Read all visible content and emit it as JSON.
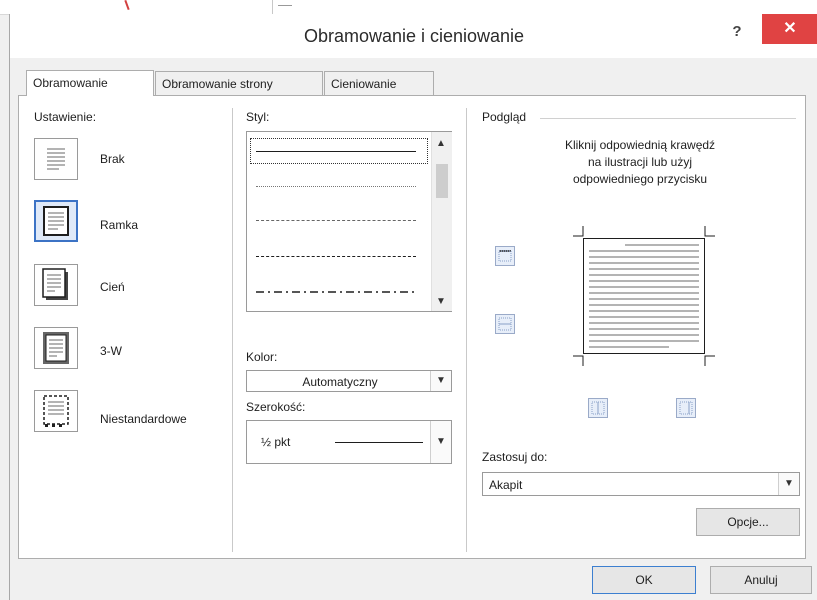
{
  "window": {
    "title": "Obramowanie i cieniowanie",
    "help_label": "?",
    "close_label": "✕"
  },
  "tabs": [
    {
      "label": "Obramowanie",
      "active": true
    },
    {
      "label": "Obramowanie strony",
      "active": false
    },
    {
      "label": "Cieniowanie",
      "active": false
    }
  ],
  "settings": {
    "heading": "Ustawienie:",
    "items": [
      {
        "label": "Brak",
        "icon": "no-border-icon"
      },
      {
        "label": "Ramka",
        "icon": "box-border-icon",
        "selected": true
      },
      {
        "label": "Cień",
        "icon": "shadow-border-icon"
      },
      {
        "label": "3-W",
        "icon": "3d-border-icon"
      },
      {
        "label": "Niestandardowe",
        "icon": "custom-border-icon"
      }
    ]
  },
  "style": {
    "heading": "Styl:",
    "options": [
      "solid",
      "dotted",
      "dashed-small",
      "dashed",
      "dash-dot"
    ],
    "selected_index": 0
  },
  "color": {
    "label": "Kolor:",
    "value": "Automatyczny"
  },
  "width": {
    "label": "Szerokość:",
    "value": "½ pkt"
  },
  "preview": {
    "heading": "Podgląd",
    "instructions_line1": "Kliknij odpowiednią krawędź",
    "instructions_line2": "na ilustracji lub użyj",
    "instructions_line3": "odpowiedniego przycisku"
  },
  "apply_to": {
    "label": "Zastosuj do:",
    "value": "Akapit"
  },
  "buttons": {
    "options": "Opcje...",
    "ok": "OK",
    "cancel": "Anuluj"
  },
  "colors": {
    "accent": "#3c73c5",
    "close": "#e04343"
  }
}
